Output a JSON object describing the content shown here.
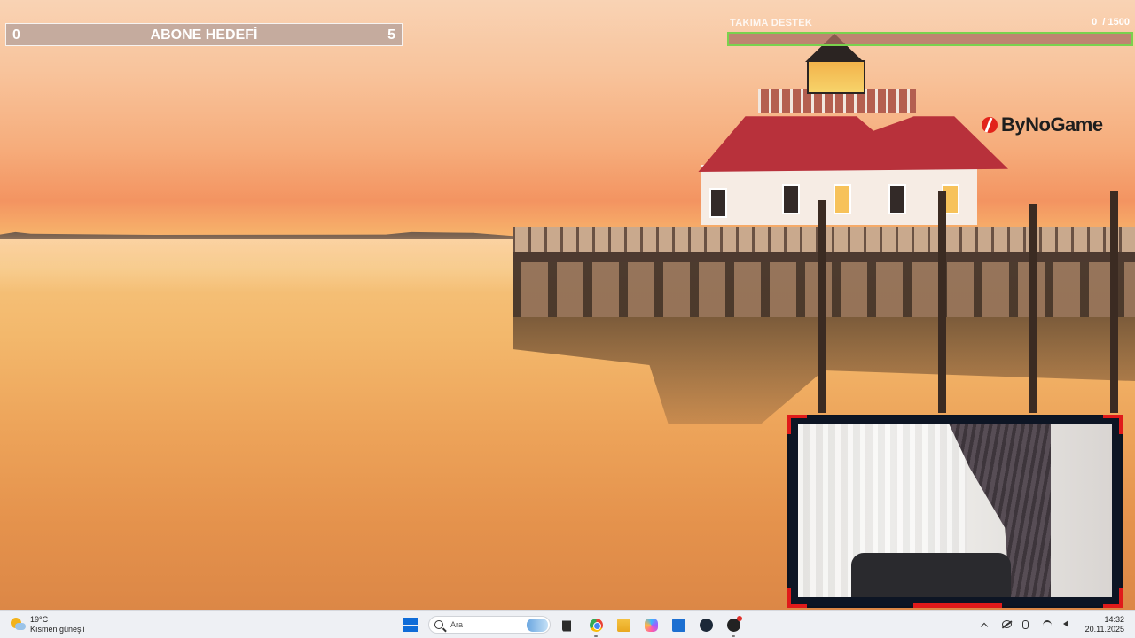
{
  "overlay": {
    "subscriber_goal": {
      "label": "ABONE HEDEFİ",
      "current": "0",
      "target": "5"
    },
    "team_support": {
      "label": "TAKIMA DESTEK",
      "current": "0",
      "target": "/ 1500",
      "progress": 0
    },
    "brand": {
      "name": "ByNoGame",
      "icon": "bynogame-logo-icon"
    },
    "webcam": {
      "accent_color": "#e01a1a",
      "frame_color": "#0d1524"
    }
  },
  "taskbar": {
    "weather": {
      "temperature": "19°C",
      "condition": "Kısmen güneşli",
      "icon": "partly-sunny-icon"
    },
    "search": {
      "placeholder": "Ara"
    },
    "pinned_apps": [
      {
        "name": "start",
        "icon": "windows-logo-icon"
      },
      {
        "name": "task-view",
        "icon": "task-view-icon"
      },
      {
        "name": "chrome",
        "icon": "chrome-icon"
      },
      {
        "name": "file-explorer",
        "icon": "folder-icon"
      },
      {
        "name": "copilot",
        "icon": "copilot-icon"
      },
      {
        "name": "microsoft-store",
        "icon": "store-icon"
      },
      {
        "name": "steam",
        "icon": "steam-icon"
      },
      {
        "name": "obs",
        "icon": "obs-icon"
      }
    ],
    "tray": [
      "chevron-up-icon",
      "onedrive-icon",
      "microphone-icon",
      "wifi-icon",
      "volume-icon"
    ],
    "clock": {
      "time": "14:32",
      "date": "20.11.2025"
    }
  },
  "colors": {
    "goal_bar_bg": "#c0a89d",
    "support_bar_border": "#7ad24e",
    "taskbar_bg": "#eef0f4"
  }
}
